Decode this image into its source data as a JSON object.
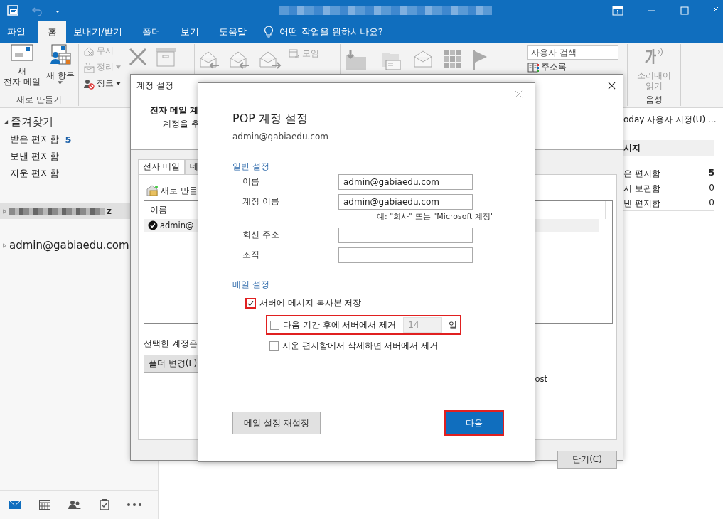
{
  "ribbon_tabs": [
    {
      "label": "파일",
      "selected": false
    },
    {
      "label": "홈",
      "selected": true
    },
    {
      "label": "보내기/받기",
      "selected": false
    },
    {
      "label": "폴더",
      "selected": false
    },
    {
      "label": "보기",
      "selected": false
    },
    {
      "label": "도움말",
      "selected": false
    }
  ],
  "tell_me": "어떤 작업을 원하시나요?",
  "ribbon": {
    "new_email": [
      "새",
      "전자 메일"
    ],
    "new_item": "새 항목",
    "new_group_label": "새로 만들기",
    "small_actions": [
      {
        "label": "무시",
        "has_menu": false,
        "disabled": true
      },
      {
        "label": "정리",
        "has_menu": true,
        "disabled": true
      },
      {
        "label": "정크",
        "has_menu": true,
        "disabled": false
      }
    ],
    "meeting": {
      "label": "모임",
      "disabled": true
    },
    "search": {
      "placeholder": "사용자 검색"
    },
    "address_book": "주소록",
    "read_aloud": [
      "소리내어",
      "읽기"
    ],
    "voice_group_label": "음성"
  },
  "sidebar": {
    "favorites": {
      "label": "즐겨찾기",
      "expanded": true,
      "children": [
        {
          "label": "받은 편지함",
          "count": "5"
        },
        {
          "label": "보낸 편지함"
        },
        {
          "label": "지운 편지함"
        }
      ]
    },
    "accounts": [
      {
        "label": "z",
        "redacted": true,
        "selected": true,
        "expanded": false
      },
      {
        "label": "admin@gabiaedu.com",
        "redacted": false,
        "selected": false,
        "expanded": false
      }
    ]
  },
  "nav": [
    {
      "kind": "mail",
      "selected": true
    },
    {
      "kind": "calendar",
      "selected": false
    },
    {
      "kind": "people",
      "selected": false
    },
    {
      "kind": "tasks",
      "selected": false
    },
    {
      "kind": "more",
      "selected": false
    }
  ],
  "right_pane": {
    "header_link": "oday 사용자 지정(U) ...",
    "section": "시지",
    "folders": [
      {
        "name": "은 편지함",
        "count": "5",
        "bold": true
      },
      {
        "name": "시 보관함",
        "count": "0",
        "bold": false
      },
      {
        "name": "낸 편지함",
        "count": "0",
        "bold": false
      }
    ]
  },
  "account_settings_dialog": {
    "title": "계정 설정",
    "heading": "전자 메일 계",
    "subheading": "계정을 추",
    "tabs": [
      {
        "label": "전자 메일",
        "selected": true
      },
      {
        "label": "데",
        "selected": false
      }
    ],
    "new_button": "새로 만들",
    "list_header": "이름",
    "accounts": [
      {
        "name": "admin@",
        "default": true
      }
    ],
    "selected_account_text": "선택한 계정은",
    "folder_button": "폴더 변경(F)",
    "path_tail": "ost",
    "close_button": "닫기(C)"
  },
  "pop_dialog": {
    "title": "POP 계정 설정",
    "email": "admin@gabiaedu.com",
    "general_section": "일반 설정",
    "fields": [
      {
        "label": "이름",
        "value": "admin@gabiaedu.com"
      },
      {
        "label": "계정 이름",
        "value": "admin@gabiaedu.com",
        "hint": "예: \"회사\" 또는 \"Microsoft 계정\""
      },
      {
        "label": "회신 주소"
      },
      {
        "label": "조직"
      }
    ],
    "mail_section": "메일 설정",
    "options": [
      {
        "kind": "checkbox",
        "label": "서버에 메시지 복사본 저장",
        "checked": true,
        "highlighted": true,
        "children": [
          {
            "kind": "period",
            "label": "다음 기간 후에 서버에서 제거",
            "checked": false,
            "highlighted": true,
            "value": "14",
            "unit": "일"
          },
          {
            "kind": "checkbox",
            "label": "지운 편지함에서 삭제하면 서버에서 제거",
            "checked": false,
            "highlighted": false
          }
        ]
      }
    ],
    "buttons": [
      {
        "label": "메일 설정 재설정",
        "primary": false,
        "highlighted": false
      },
      {
        "label": "다음",
        "primary": true,
        "highlighted": true
      }
    ]
  }
}
